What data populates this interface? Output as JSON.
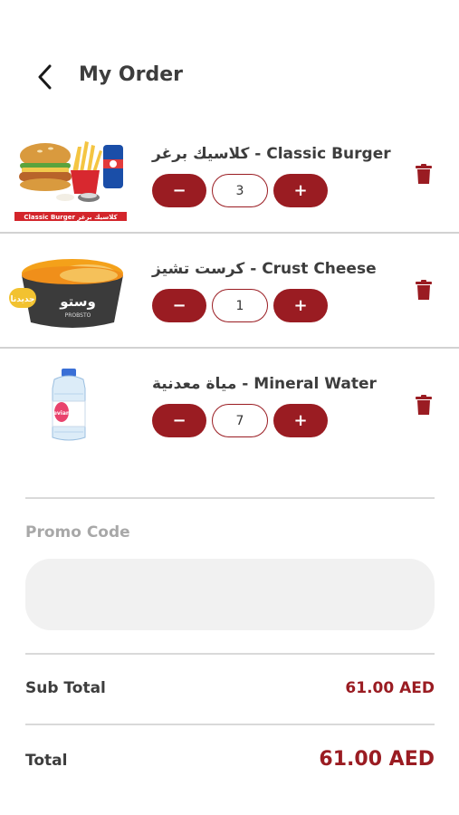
{
  "header": {
    "title": "My Order",
    "back_icon": "chevron-left-icon"
  },
  "items": [
    {
      "name": "كلاسيك برغر - Classic Burger",
      "qty": "3",
      "image_label": "Classic Burger  كلاسيك برغر",
      "image": "classic-burger-combo"
    },
    {
      "name": "كرست تشيز - Crust Cheese",
      "qty": "1",
      "image_label": "جديدنا",
      "image": "crust-cheese-bowl"
    },
    {
      "name": "مياة معدنية - Mineral Water",
      "qty": "7",
      "image_label": "evian",
      "image": "water-bottle"
    }
  ],
  "stepper": {
    "minus": "−",
    "plus": "+"
  },
  "promo": {
    "label": "Promo Code",
    "value": "",
    "placeholder": ""
  },
  "summary": {
    "subtotal_label": "Sub Total",
    "subtotal_value": "61.00 AED",
    "total_label": "Total",
    "total_value": "61.00 AED"
  },
  "colors": {
    "accent": "#9a1c22",
    "text": "#3d3d3d",
    "muted": "#a8a8a8",
    "field": "#f1f1f1"
  }
}
